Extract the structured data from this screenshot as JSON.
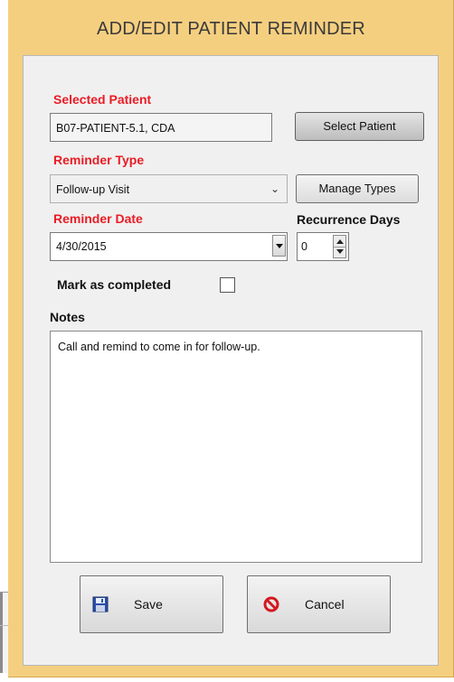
{
  "window": {
    "title": "ADD/EDIT PATIENT REMINDER"
  },
  "form": {
    "selected_patient_label": "Selected Patient",
    "selected_patient_value": "B07-PATIENT-5.1, CDA",
    "select_patient_button": "Select Patient",
    "reminder_type_label": "Reminder Type",
    "reminder_type_value": "Follow-up Visit",
    "manage_types_button": "Manage Types",
    "reminder_date_label": "Reminder Date",
    "reminder_date_value": "4/30/2015",
    "recurrence_days_label": "Recurrence Days",
    "recurrence_days_value": "0",
    "mark_completed_label": "Mark as completed",
    "mark_completed_checked": false,
    "notes_label": "Notes",
    "notes_value": "Call and remind to come in for follow-up."
  },
  "buttons": {
    "save": "Save",
    "cancel": "Cancel"
  },
  "icons": {
    "save": "floppy-disk-icon",
    "cancel": "no-entry-icon",
    "dropdown": "chevron-down-icon",
    "date_drop": "dropdown-triangle-icon"
  },
  "colors": {
    "title_bar": "#f5cf80",
    "required_label": "#ea1c25",
    "panel": "#f0f0f0"
  }
}
